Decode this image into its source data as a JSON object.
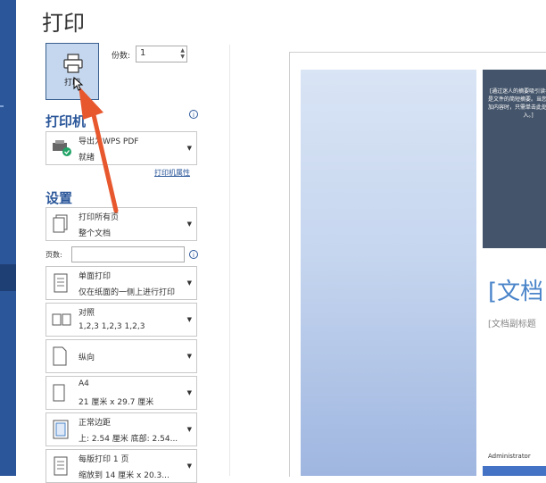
{
  "title": "打印",
  "print_button": {
    "label": "打印"
  },
  "copies": {
    "label": "份数:",
    "value": "1"
  },
  "printer_section": {
    "heading": "打印机",
    "name": "导出为WPS PDF",
    "status": "就绪",
    "properties_link": "打印机属性"
  },
  "settings_section": {
    "heading": "设置",
    "pages_label": "页数:",
    "items": [
      {
        "line1": "打印所有页",
        "line2": "整个文档"
      },
      {
        "line1": "单面打印",
        "line2": "仅在纸面的一侧上进行打印"
      },
      {
        "line1": "对照",
        "line2": "1,2,3    1,2,3    1,2,3"
      },
      {
        "line1": "纵向",
        "line2": ""
      },
      {
        "line1": "A4",
        "line2": "21 厘米 x 29.7 厘米"
      },
      {
        "line1": "正常边距",
        "line2": "上: 2.54 厘米 底部: 2.54..."
      },
      {
        "line1": "每版打印 1 页",
        "line2": "缩放到 14 厘米 x 20.3..."
      }
    ]
  },
  "preview": {
    "box_text": "[通过迷人的摘要吸引读者。通常是文件的简短摘要。当您准备好添加内容时，只需单击此处并开始键入。]",
    "doc_title": "[文档",
    "doc_subtitle": "[文档副标题",
    "author": "Administrator"
  },
  "colors": {
    "accent": "#2b579a",
    "arrow": "#e8582e"
  }
}
